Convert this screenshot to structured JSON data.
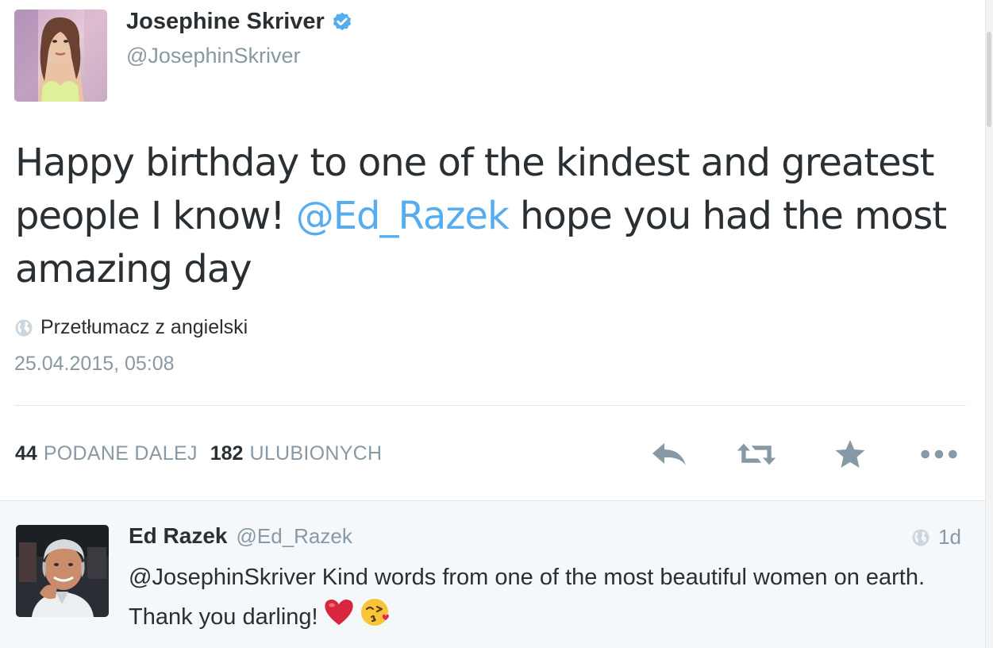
{
  "tweet": {
    "author_name": "Josephine Skriver",
    "author_handle": "@JosephinSkriver",
    "verified": true,
    "text_before": "Happy birthday to one of the kindest and greatest people I know! ",
    "mention": "@Ed_Razek",
    "text_after": " hope you had the most amazing day",
    "translate_label": "Przetłumacz z angielski",
    "timestamp": "25.04.2015, 05:08"
  },
  "stats": {
    "retweets_count": "44",
    "retweets_label": "PODANE DALEJ",
    "favorites_count": "182",
    "favorites_label": "ULUBIONYCH"
  },
  "actions": {
    "reply_icon": "reply-icon",
    "retweet_icon": "retweet-icon",
    "favorite_icon": "star-icon",
    "more_icon": "more-icon"
  },
  "reply": {
    "author_name": "Ed Razek",
    "author_handle": "@Ed_Razek",
    "age": "1d",
    "text": "@JosephinSkriver Kind words from one of the most beautiful women on earth. Thank you darling!",
    "emoji_1": "red-heart",
    "emoji_2": "face-blowing-kiss"
  },
  "colors": {
    "accent": "#55acee",
    "text": "#292f33",
    "muted": "#8899a6",
    "verified": "#55acee",
    "reply_bg": "#f5f8fa",
    "heart": "#d7263d"
  }
}
